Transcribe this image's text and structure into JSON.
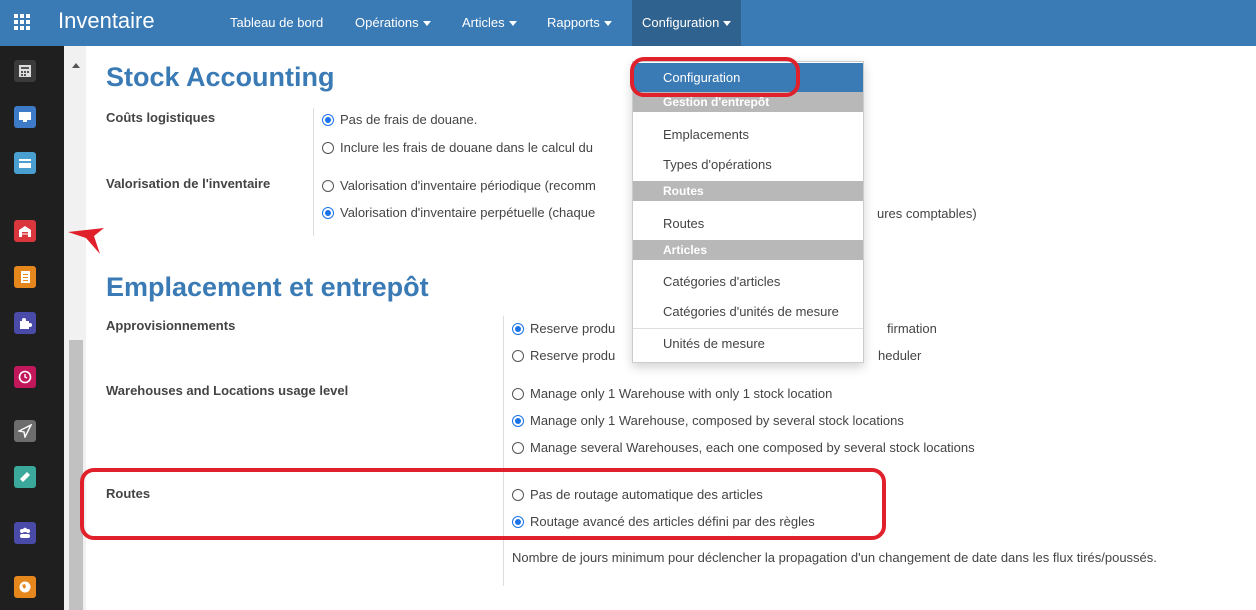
{
  "topbar": {
    "app_title": "Inventaire",
    "menu": [
      {
        "label": "Tableau de bord"
      },
      {
        "label": "Opérations"
      },
      {
        "label": "Articles"
      },
      {
        "label": "Rapports"
      },
      {
        "label": "Configuration"
      }
    ]
  },
  "leftbar": {
    "icons": [
      {
        "name": "calculator-icon",
        "color": "#3b3b3b"
      },
      {
        "name": "monitor-icon",
        "color": "#3d7ac7"
      },
      {
        "name": "credit-card-icon",
        "color": "#4a9fd1"
      },
      {
        "name": "warehouse-icon",
        "color": "#d9363e"
      },
      {
        "name": "document-icon",
        "color": "#e6871e"
      },
      {
        "name": "puzzle-icon",
        "color": "#4a4aa8"
      },
      {
        "name": "clock-icon",
        "color": "#c2185b"
      },
      {
        "name": "send-icon",
        "color": "#6d6d6d"
      },
      {
        "name": "ticket-icon",
        "color": "#3aa89a"
      },
      {
        "name": "users-icon",
        "color": "#4a4aa8"
      },
      {
        "name": "globe-icon",
        "color": "#e6871e"
      }
    ]
  },
  "stock_accounting": {
    "title": "Stock Accounting",
    "couts_label": "Coûts logistiques",
    "couts_options": [
      {
        "label": "Pas de frais de douane.",
        "checked": true
      },
      {
        "label": "Inclure les frais de douane dans le calcul du",
        "checked": false
      }
    ],
    "valorisation_label": "Valorisation de l'inventaire",
    "valorisation_options": [
      {
        "label": "Valorisation d'inventaire périodique (recomm",
        "checked": false
      },
      {
        "label": "Valorisation d'inventaire perpétuelle (chaque",
        "checked": true
      }
    ],
    "valorisation_tail": "ures comptables)"
  },
  "emplacement": {
    "title": "Emplacement et entrepôt",
    "approv_label": "Approvisionnements",
    "approv_options": [
      {
        "label": "Reserve produ",
        "checked": true,
        "tail": "firmation"
      },
      {
        "label": "Reserve produ",
        "checked": false,
        "tail": "heduler"
      }
    ],
    "usage_label": "Warehouses and Locations usage level",
    "usage_options": [
      {
        "label": "Manage only 1 Warehouse with only 1 stock location",
        "checked": false
      },
      {
        "label": "Manage only 1 Warehouse, composed by several stock locations",
        "checked": true
      },
      {
        "label": "Manage several Warehouses, each one composed by several stock locations",
        "checked": false
      }
    ],
    "routes_label": "Routes",
    "routes_options": [
      {
        "label": "Pas de routage automatique des articles",
        "checked": false
      },
      {
        "label": "Routage avancé des articles défini par des règles",
        "checked": true
      }
    ],
    "routes_note": "Nombre de jours minimum pour déclencher la propagation d'un changement de date dans les flux tirés/poussés."
  },
  "dropdown": {
    "configuration": "Configuration",
    "header_gestion": "Gestion d'entrepôt",
    "emplacements": "Emplacements",
    "types_operations": "Types d'opérations",
    "header_routes": "Routes",
    "routes": "Routes",
    "header_articles": "Articles",
    "categories_articles": "Catégories d'articles",
    "categories_unites": "Catégories d'unités de mesure",
    "unites_mesure": "Unités de mesure"
  },
  "colors": {
    "topbar": "#3a7ab5",
    "accent": "#3a7ab5",
    "highlight": "#e0202a"
  }
}
